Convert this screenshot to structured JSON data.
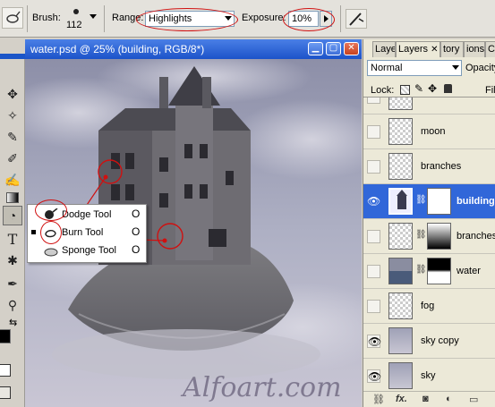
{
  "options_bar": {
    "brush_label": "Brush:",
    "brush_size": "112",
    "range_label": "Range:",
    "range_value": "Highlights",
    "exposure_label": "Exposure:",
    "exposure_value": "10%"
  },
  "document": {
    "title": "water.psd @ 25% (building, RGB/8*)",
    "watermark": "Alfoart.com"
  },
  "tool_flyout": {
    "items": [
      {
        "label": "Dodge Tool",
        "key": "O",
        "selected": false
      },
      {
        "label": "Burn Tool",
        "key": "O",
        "selected": true
      },
      {
        "label": "Sponge Tool",
        "key": "O",
        "selected": false
      }
    ]
  },
  "layers_panel": {
    "tabs": [
      "Laye",
      "Layers",
      "tory",
      "ions",
      "Char"
    ],
    "blend_mode": "Normal",
    "opacity_label": "Opacity",
    "lock_label": "Lock:",
    "fill_label": "Fil",
    "layers": [
      {
        "name": "",
        "visible": false,
        "thumb": "blank",
        "selected": false
      },
      {
        "name": "moon",
        "visible": false,
        "thumb": "blank",
        "selected": false
      },
      {
        "name": "branches",
        "visible": false,
        "thumb": "blank",
        "selected": false
      },
      {
        "name": "building",
        "visible": true,
        "thumb": "building",
        "mask": "white",
        "selected": true
      },
      {
        "name": "branches",
        "visible": false,
        "thumb": "blank",
        "mask": "gradient",
        "selected": false
      },
      {
        "name": "water",
        "visible": false,
        "thumb": "water",
        "mask": "black-white",
        "selected": false
      },
      {
        "name": "fog",
        "visible": false,
        "thumb": "blank",
        "selected": false
      },
      {
        "name": "sky copy",
        "visible": true,
        "thumb": "sky",
        "selected": false
      },
      {
        "name": "sky",
        "visible": true,
        "thumb": "sky",
        "selected": false
      }
    ],
    "footer_icons": [
      "link-icon",
      "fx-icon",
      "mask-icon",
      "adjustment-icon",
      "folder-icon"
    ],
    "footer_fx": "fx."
  },
  "colors": {
    "annotation_red": "#d01010",
    "selection_blue": "#3167d9",
    "title_blue": "#1c53c9"
  }
}
